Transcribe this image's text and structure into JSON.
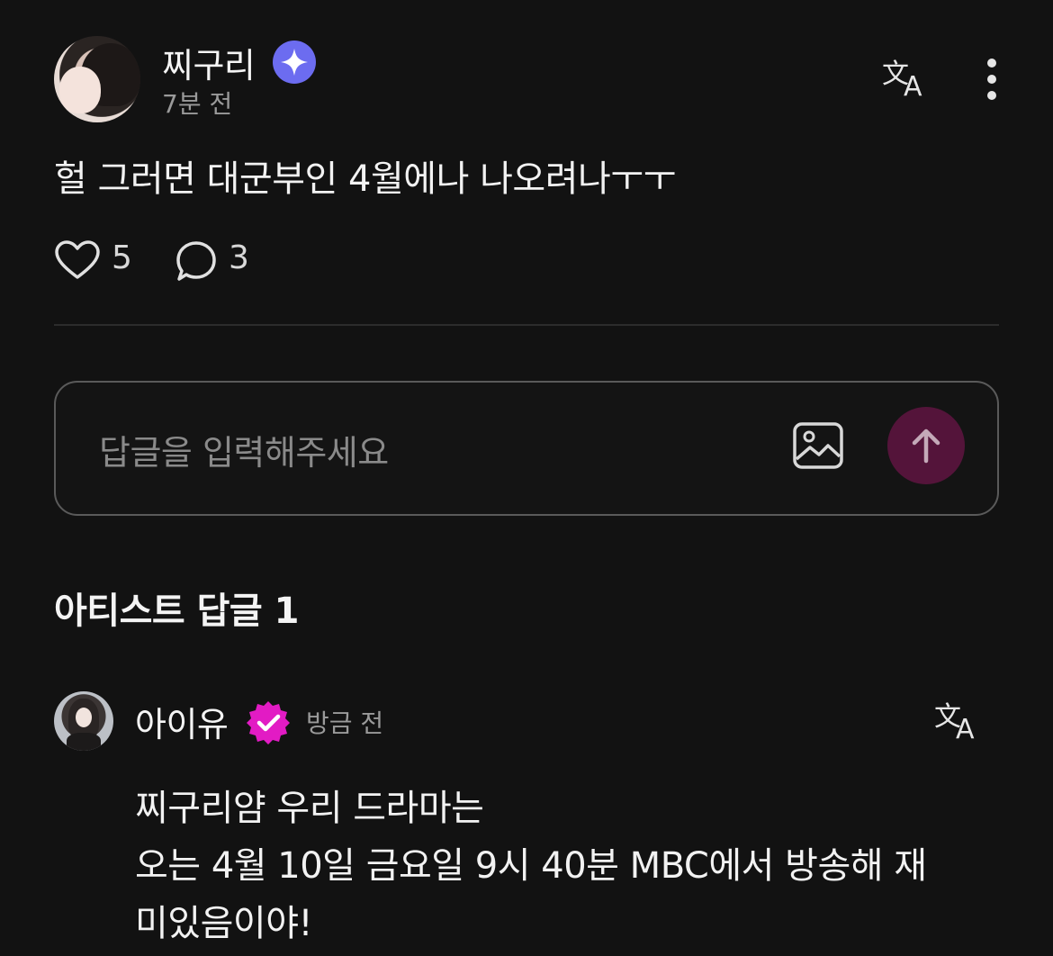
{
  "post": {
    "username": "찌구리",
    "time": "7분 전",
    "body": "헐 그러면 대군부인 4월에나 나오려나ㅜㅜ",
    "like_count": "5",
    "comment_count": "3"
  },
  "reply_input": {
    "placeholder": "답글을 입력해주세요"
  },
  "artist_replies": {
    "section_title": "아티스트 답글 1",
    "items": [
      {
        "name": "아이유",
        "time": "방금 전",
        "lines": [
          "찌구리얌 우리 드라마는",
          "오는 4월 10일 금요일 9시 40분 MBC에서 방송해 재",
          "미있음이야!"
        ]
      }
    ]
  },
  "colors": {
    "background": "#121212",
    "sparkle_badge": "#6c6cf0",
    "verified_badge": "#e21bc4",
    "send_button": "#54143a",
    "muted_text": "#9a9a9a"
  },
  "icons": [
    "sparkle-badge-icon",
    "translate-icon",
    "more-vertical-icon",
    "heart-icon",
    "comment-icon",
    "image-icon",
    "arrow-up-icon",
    "verified-badge-icon"
  ]
}
